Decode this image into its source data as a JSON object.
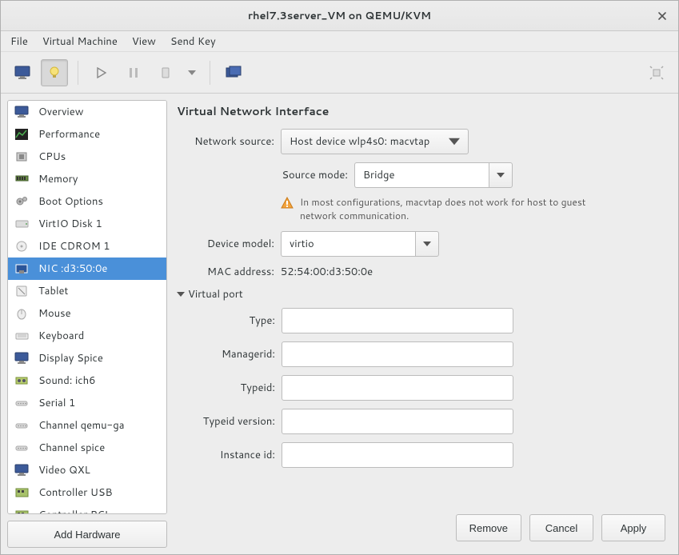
{
  "window": {
    "title": "rhel7.3server_VM on QEMU/KVM"
  },
  "menubar": {
    "file": "File",
    "vm": "Virtual Machine",
    "view": "View",
    "sendkey": "Send Key"
  },
  "sidebar": {
    "items": [
      {
        "label": "Overview",
        "icon": "monitor"
      },
      {
        "label": "Performance",
        "icon": "chart"
      },
      {
        "label": "CPUs",
        "icon": "cpu"
      },
      {
        "label": "Memory",
        "icon": "ram"
      },
      {
        "label": "Boot Options",
        "icon": "gears"
      },
      {
        "label": "VirtIO Disk 1",
        "icon": "disk"
      },
      {
        "label": "IDE CDROM 1",
        "icon": "cdrom"
      },
      {
        "label": "NIC :d3:50:0e",
        "icon": "nic",
        "selected": true
      },
      {
        "label": "Tablet",
        "icon": "tablet"
      },
      {
        "label": "Mouse",
        "icon": "mouse"
      },
      {
        "label": "Keyboard",
        "icon": "keyboard"
      },
      {
        "label": "Display Spice",
        "icon": "monitor"
      },
      {
        "label": "Sound: ich6",
        "icon": "sound"
      },
      {
        "label": "Serial 1",
        "icon": "serial"
      },
      {
        "label": "Channel qemu-ga",
        "icon": "serial"
      },
      {
        "label": "Channel spice",
        "icon": "serial"
      },
      {
        "label": "Video QXL",
        "icon": "monitor"
      },
      {
        "label": "Controller USB",
        "icon": "controller"
      },
      {
        "label": "Controller PCI",
        "icon": "controller"
      }
    ]
  },
  "add_hardware_label": "Add Hardware",
  "detail": {
    "title": "Virtual Network Interface",
    "network_source_label": "Network source:",
    "network_source_value": "Host device wlp4s0: macvtap",
    "source_mode_label": "Source mode:",
    "source_mode_value": "Bridge",
    "warning": "In most configurations, macvtap does not work for host to guest network communication.",
    "device_model_label": "Device model:",
    "device_model_value": "virtio",
    "mac_label": "MAC address:",
    "mac_value": "52:54:00:d3:50:0e",
    "virtual_port": {
      "header": "Virtual port",
      "type_label": "Type:",
      "type_value": "",
      "managerid_label": "Managerid:",
      "managerid_value": "",
      "typeid_label": "Typeid:",
      "typeid_value": "",
      "typeid_version_label": "Typeid version:",
      "typeid_version_value": "",
      "instanceid_label": "Instance id:",
      "instanceid_value": ""
    }
  },
  "footer": {
    "remove": "Remove",
    "cancel": "Cancel",
    "apply": "Apply"
  }
}
